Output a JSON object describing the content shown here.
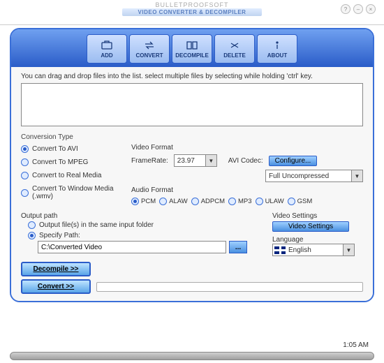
{
  "titlebar": {
    "brand": "BULLETPROOFSOFT",
    "subtitle": "VIDEO CONVERTER & DECOMPILER"
  },
  "toolbar": {
    "add": "ADD",
    "convert": "CONVERT",
    "decompile": "DECOMPILE",
    "delete": "DELETE",
    "about": "ABOUT"
  },
  "hint": "You can drag and drop files into the list. select multiple files by selecting while holding 'ctrl' key.",
  "conversion": {
    "label": "Conversion Type",
    "options": {
      "avi": "Convert To AVI",
      "mpeg": "Convert To MPEG",
      "real": "Convert to Real Media",
      "wmv": "Convert To Window Media (.wmv)"
    },
    "selected": "avi"
  },
  "video_format": {
    "label": "Video Format",
    "framerate_label": "FrameRate:",
    "framerate_value": "23.97",
    "codec_label": "AVI Codec:",
    "configure": "Configure...",
    "codec_value": "Full Uncompressed"
  },
  "audio_format": {
    "label": "Audio Format",
    "options": {
      "pcm": "PCM",
      "alaw": "ALAW",
      "adpcm": "ADPCM",
      "mp3": "MP3",
      "ulaw": "ULAW",
      "gsm": "GSM"
    },
    "selected": "pcm"
  },
  "output": {
    "label": "Output path",
    "same_folder": "Output file(s) in the same input folder",
    "specify": "Specify Path:",
    "path_value": "C:\\Converted Video",
    "selected": "specify"
  },
  "video_settings": {
    "label": "Video Settings",
    "button": "Video Settings"
  },
  "language": {
    "label": "Language",
    "value": "English"
  },
  "actions": {
    "decompile": "Decompile >>",
    "convert": "Convert >>"
  },
  "status": {
    "time": "1:05 AM"
  }
}
